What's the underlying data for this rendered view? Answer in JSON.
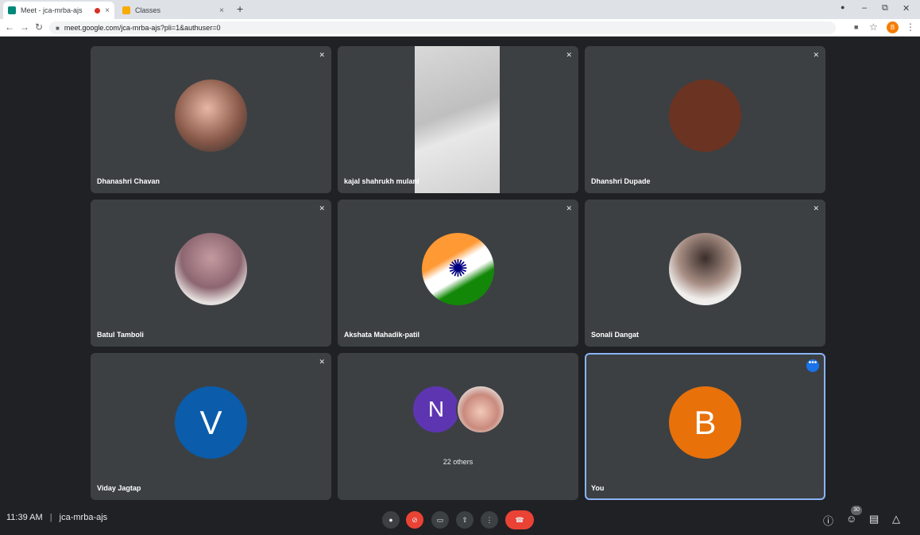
{
  "browser": {
    "tabs": [
      {
        "title": "Meet - jca-mrba-ajs",
        "active": true,
        "close": "×"
      },
      {
        "title": "Classes",
        "active": false,
        "close": "×"
      }
    ],
    "new_tab": "+",
    "window_controls": {
      "minimize": "–",
      "restore": "⧉",
      "close": "✕"
    },
    "url": "meet.google.com/jca-mrba-ajs?pli=1&authuser=0",
    "profile_initial": "B"
  },
  "tiles": [
    {
      "name": "Dhanashri Chavan",
      "muted": true
    },
    {
      "name": "kajal shahrukh mulani",
      "muted": true
    },
    {
      "name": "Dhanshri Dupade",
      "muted": true
    },
    {
      "name": "Batul Tamboli",
      "muted": true
    },
    {
      "name": "Akshata Mahadik-patil",
      "muted": true
    },
    {
      "name": "Sonali Dangat",
      "muted": true
    },
    {
      "name": "Viday Jagtap",
      "muted": true,
      "initial": "V"
    },
    {
      "group_initial": "N",
      "others_label": "22 others"
    },
    {
      "name": "You",
      "initial": "B",
      "more": "•••"
    }
  ],
  "meeting": {
    "time": "11:39 AM",
    "separator": "|",
    "code": "jca-mrba-ajs",
    "participants_count": "30"
  },
  "colors": {
    "background": "#202124",
    "tile": "#3c4043",
    "accent_blue": "#1a73e8",
    "end_call_red": "#ea4335",
    "avatar_v": "#0b5cab",
    "avatar_b": "#e8710a",
    "avatar_n": "#5e35b1"
  }
}
